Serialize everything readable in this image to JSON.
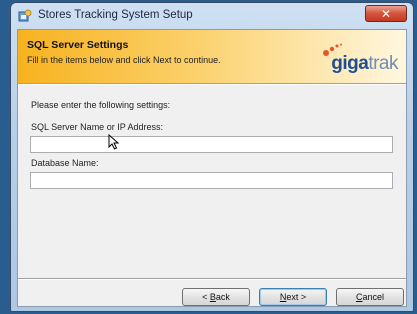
{
  "window": {
    "title": "Stores Tracking System Setup",
    "close_label": "✕"
  },
  "banner": {
    "title": "SQL Server Settings",
    "subtitle": "Fill in the items below and click Next to continue.",
    "logo": {
      "part1": "gi",
      "part2": "ga",
      "part3": "trak"
    }
  },
  "form": {
    "prompt": "Please enter the following settings:",
    "server": {
      "label": "SQL Server Name or IP Address:",
      "value": "",
      "placeholder": ""
    },
    "database": {
      "label": "Database Name:",
      "value": "",
      "placeholder": ""
    }
  },
  "buttons": {
    "back": {
      "prefix": "< ",
      "mnemonic": "B",
      "rest": "ack"
    },
    "next": {
      "mnemonic": "N",
      "rest": "ext >"
    },
    "cancel": {
      "mnemonic": "C",
      "rest": "ancel"
    }
  },
  "colors": {
    "banner_orange": "#f7b21f",
    "logo_blue": "#1f4f93",
    "logo_light": "#6f8fb9"
  }
}
